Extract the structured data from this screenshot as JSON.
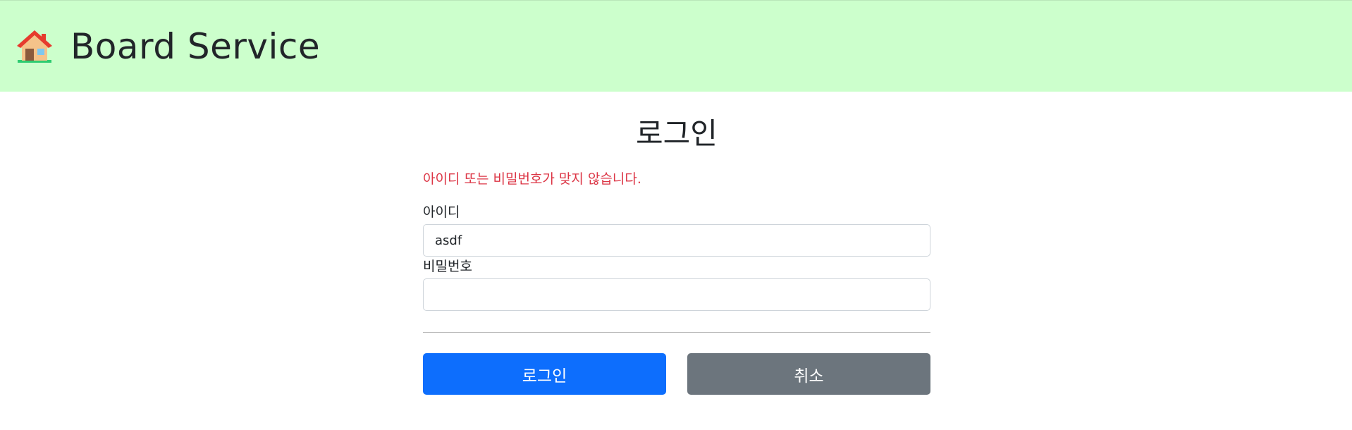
{
  "header": {
    "brand": "Board Service",
    "home_icon": "house-emoji",
    "background": "#ccffcc"
  },
  "login": {
    "title": "로그인",
    "error_message": "아이디 또는 비밀번호가 맞지 않습니다.",
    "username_label": "아이디",
    "username_value": "asdf",
    "password_label": "비밀번호",
    "password_value": "",
    "submit_label": "로그인",
    "cancel_label": "취소"
  },
  "colors": {
    "primary": "#0d6efd",
    "secondary": "#6c757d",
    "danger": "#dc3545"
  }
}
